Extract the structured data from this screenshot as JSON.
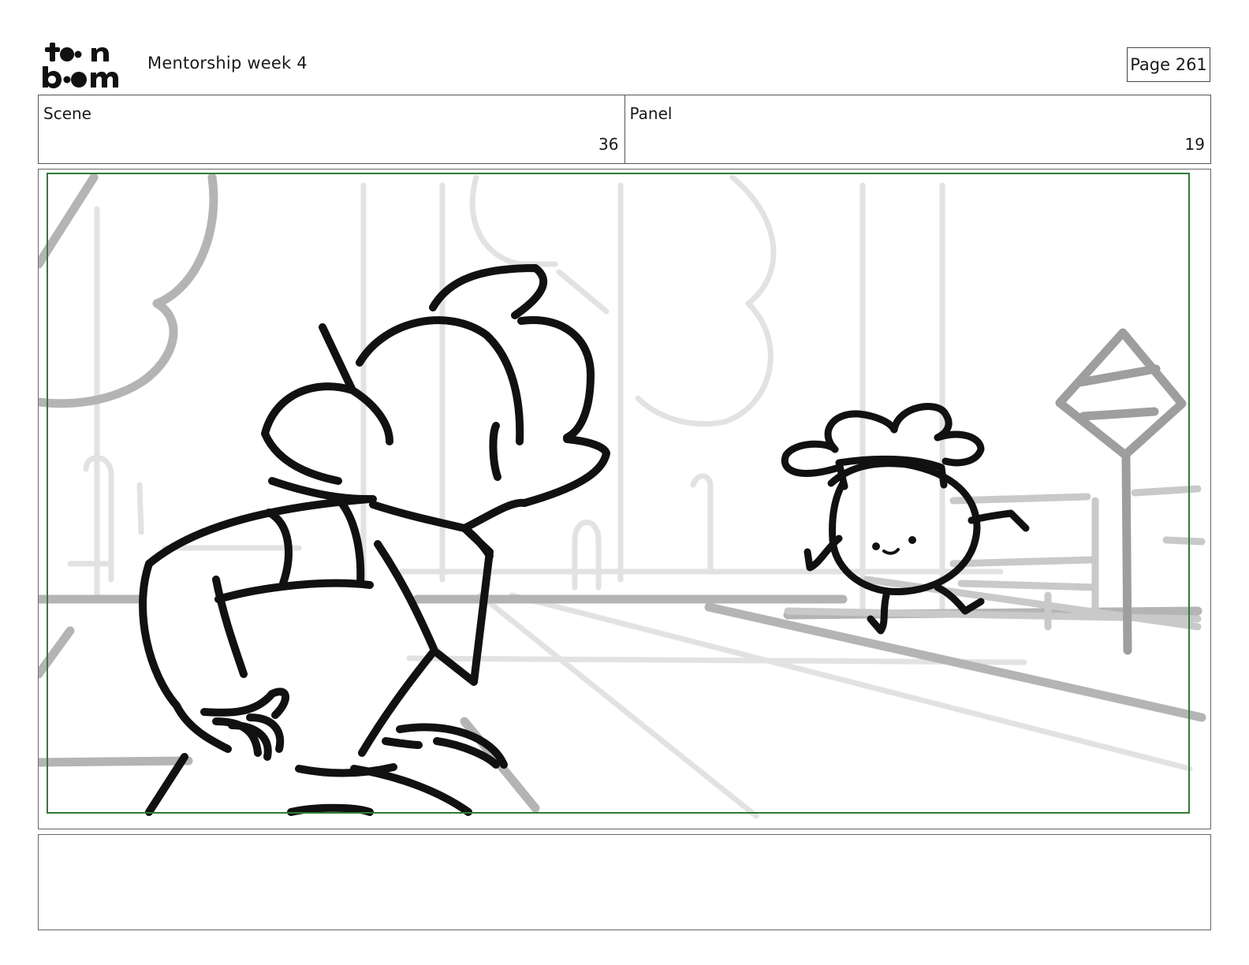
{
  "header": {
    "logo_text": "toon boom",
    "project_title": "Mentorship week 4",
    "page_label": "Page 261"
  },
  "info": {
    "scene_label": "Scene",
    "scene_value": "36",
    "panel_label": "Panel",
    "panel_value": "19"
  },
  "panel": {
    "frame_color": "#2e7d32",
    "description": "",
    "icon": "storyboard-sketch"
  },
  "caption": {
    "text": ""
  }
}
